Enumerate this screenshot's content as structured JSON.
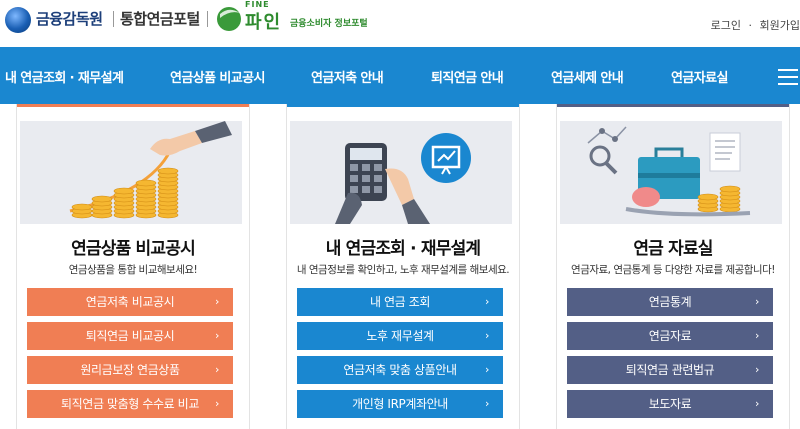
{
  "header": {
    "fss_name": "금융감독원",
    "portal_name": "통합연금포털",
    "fine_small": "FINE",
    "fine_big": "파인",
    "fine_sub": "금융소비자 정보포털",
    "util": {
      "login": "로그인",
      "dot": "·",
      "join": "회원가입"
    }
  },
  "nav": {
    "items": [
      "내 연금조회 · 재무설계",
      "연금상품 비교공시",
      "연금저축 안내",
      "퇴직연금 안내",
      "연금세제 안내",
      "연금자료실"
    ]
  },
  "panels": [
    {
      "title": "연금상품 비교공시",
      "desc": "연금상품을 통합 비교해보세요!",
      "buttons": [
        "연금저축 비교공시",
        "퇴직연금 비교공시",
        "원리금보장 연금상품",
        "퇴직연금 맞춤형 수수료 비교"
      ]
    },
    {
      "title": "내 연금조회 · 재무설계",
      "desc": "내 연금정보를 확인하고, 노후 재무설계를 해보세요.",
      "buttons": [
        "내 연금 조회",
        "노후 재무설계",
        "연금저축 맞춤 상품안내",
        "개인형 IRP계좌안내"
      ]
    },
    {
      "title": "연금 자료실",
      "desc": "연금자료, 연금통계 등 다양한 자료를 제공합니다!",
      "buttons": [
        "연금통계",
        "연금자료",
        "퇴직연금 관련법규",
        "보도자료"
      ]
    }
  ],
  "arrow": "›",
  "colors": {
    "nav": "#1a87d0",
    "orange": "#f07e54",
    "blue": "#1a87d0",
    "slate": "#535f86"
  }
}
